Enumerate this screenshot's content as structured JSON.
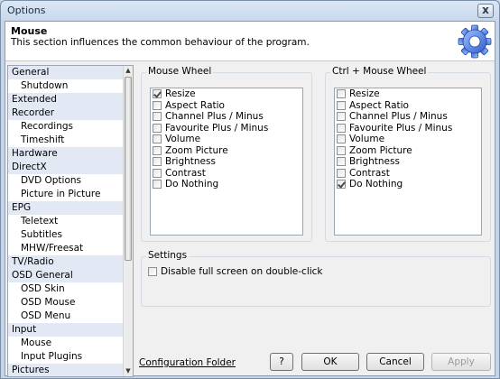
{
  "window": {
    "title": "Options",
    "close_glyph": "x"
  },
  "header": {
    "title": "Mouse",
    "description": "This section influences the common behaviour of the program.",
    "icon": "gear-icon"
  },
  "tree": {
    "items": [
      {
        "label": "General",
        "level": 0
      },
      {
        "label": "Shutdown",
        "level": 1
      },
      {
        "label": "Extended",
        "level": 0
      },
      {
        "label": "Recorder",
        "level": 0
      },
      {
        "label": "Recordings",
        "level": 1
      },
      {
        "label": "Timeshift",
        "level": 1
      },
      {
        "label": "Hardware",
        "level": 0
      },
      {
        "label": "DirectX",
        "level": 0
      },
      {
        "label": "DVD Options",
        "level": 1
      },
      {
        "label": "Picture in Picture",
        "level": 1
      },
      {
        "label": "EPG",
        "level": 0
      },
      {
        "label": "Teletext",
        "level": 1
      },
      {
        "label": "Subtitles",
        "level": 1
      },
      {
        "label": "MHW/Freesat",
        "level": 1
      },
      {
        "label": "TV/Radio",
        "level": 0
      },
      {
        "label": "OSD General",
        "level": 0
      },
      {
        "label": "OSD Skin",
        "level": 1
      },
      {
        "label": "OSD Mouse",
        "level": 1
      },
      {
        "label": "OSD Menu",
        "level": 1
      },
      {
        "label": "Input",
        "level": 0
      },
      {
        "label": "Mouse",
        "level": 1
      },
      {
        "label": "Input Plugins",
        "level": 1
      },
      {
        "label": "Pictures",
        "level": 0
      }
    ],
    "scroll_up_glyph": "▲",
    "scroll_down_glyph": "▼"
  },
  "mouse_wheel": {
    "label": "Mouse Wheel",
    "options": [
      {
        "label": "Resize",
        "checked": true
      },
      {
        "label": "Aspect Ratio",
        "checked": false
      },
      {
        "label": "Channel Plus / Minus",
        "checked": false
      },
      {
        "label": "Favourite Plus / Minus",
        "checked": false
      },
      {
        "label": "Volume",
        "checked": false
      },
      {
        "label": "Zoom Picture",
        "checked": false
      },
      {
        "label": "Brightness",
        "checked": false
      },
      {
        "label": "Contrast",
        "checked": false
      },
      {
        "label": "Do Nothing",
        "checked": false
      }
    ]
  },
  "ctrl_mouse_wheel": {
    "label": "Ctrl + Mouse Wheel",
    "options": [
      {
        "label": "Resize",
        "checked": false
      },
      {
        "label": "Aspect Ratio",
        "checked": false
      },
      {
        "label": "Channel Plus / Minus",
        "checked": false
      },
      {
        "label": "Favourite Plus / Minus",
        "checked": false
      },
      {
        "label": "Volume",
        "checked": false
      },
      {
        "label": "Zoom Picture",
        "checked": false
      },
      {
        "label": "Brightness",
        "checked": false
      },
      {
        "label": "Contrast",
        "checked": false
      },
      {
        "label": "Do Nothing",
        "checked": true
      }
    ]
  },
  "settings": {
    "label": "Settings",
    "disable_fullscreen": {
      "label": "Disable full screen on double-click",
      "checked": false
    }
  },
  "footer": {
    "config_folder_link": "Configuration Folder",
    "help_label": "?",
    "ok_label": "OK",
    "cancel_label": "Cancel",
    "apply_label": "Apply"
  },
  "colors": {
    "category_bg": "#e3e9f4",
    "gear_blue": "#3e6fd8"
  }
}
